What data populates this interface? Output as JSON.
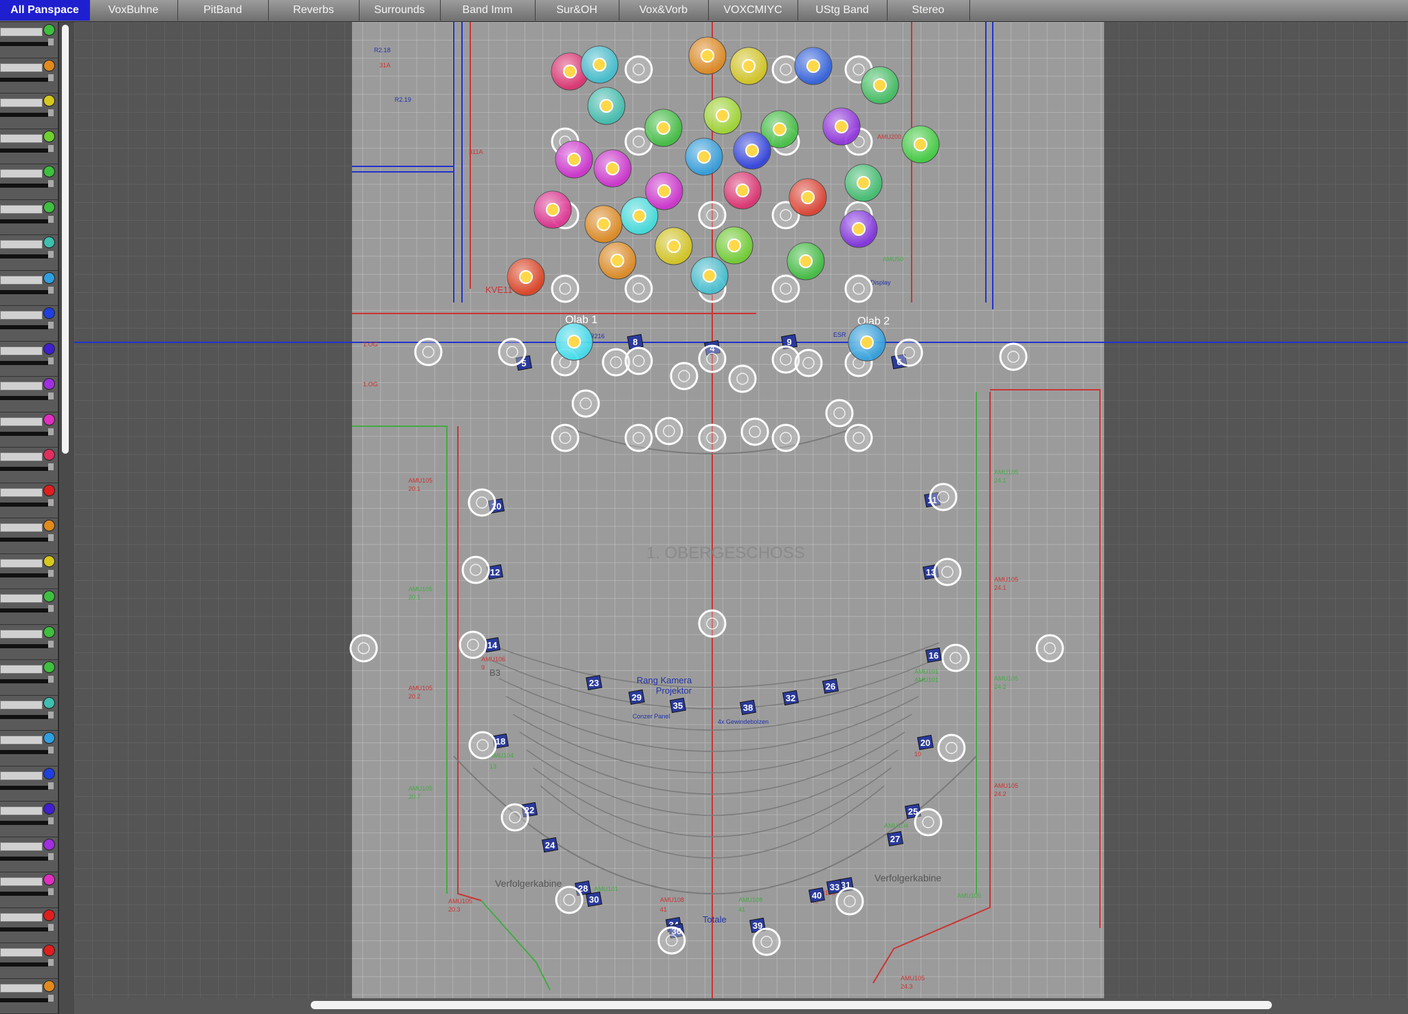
{
  "tabs": [
    {
      "label": "All Panspace",
      "active": true
    },
    {
      "label": "VoxBuhne"
    },
    {
      "label": "PitBand"
    },
    {
      "label": "Reverbs"
    },
    {
      "label": "Surrounds"
    },
    {
      "label": "Band Imm"
    },
    {
      "label": "Sur&OH"
    },
    {
      "label": "Vox&Vorb"
    },
    {
      "label": "VOXCMIYC"
    },
    {
      "label": "UStg Band"
    },
    {
      "label": "Stereo"
    }
  ],
  "channel_colors": [
    "#3fbf3f",
    "#e08a1e",
    "#d6c81e",
    "#6fcf2f",
    "#3fbf3f",
    "#3fbf3f",
    "#3fbfaf",
    "#2f9fdf",
    "#1f3fdf",
    "#3f1fcf",
    "#9f2fdf",
    "#df2fbf",
    "#df2f5f",
    "#df1f1f",
    "#e08a1e",
    "#d6c81e",
    "#3fbf3f",
    "#3fbf3f",
    "#3fbf3f",
    "#3fbfaf",
    "#2f9fdf",
    "#1f3fdf",
    "#3f1fcf",
    "#9f2fdf",
    "#df2fbf",
    "#df1f1f",
    "#df1f1f",
    "#e08a1e"
  ],
  "floorplan": {
    "title": "1. OBERGESCHOSS",
    "labels": [
      "Qlab 1",
      "Qlab 2",
      "Rang Kamera",
      "Projektor",
      "Verfolgerkabine",
      "Verfolgerkabine",
      "Totale",
      "Conzer Panel",
      "4x Gewindebolzen",
      "B3",
      "1.OG",
      "1.OG",
      "KVE11",
      "R2.18",
      "R2.19",
      "31A",
      "311A",
      "ER216",
      "ESR"
    ],
    "amu_labels": [
      "AMU105",
      "20.1",
      "AMU105",
      "20.1",
      "AMU105",
      "20.2",
      "AMU105",
      "20.7",
      "AMU105",
      "20.3",
      "AMU105",
      "24.1",
      "AMU105",
      "24.1",
      "AMU105",
      "24.2",
      "AMU105",
      "24.2",
      "AMU105",
      "24.3",
      "AMU106",
      "9",
      "AMU104",
      "13",
      "AMU108",
      "41",
      "AMU108",
      "41",
      "AMU101",
      "AMU105",
      "AMU104",
      "10",
      "AMU101",
      "AMU101",
      "AMU105",
      "40",
      "AMU200",
      "AMU50",
      "Display"
    ],
    "speaker_numbers": [
      "5",
      "6",
      "8",
      "9",
      "4",
      "10",
      "11",
      "12",
      "13",
      "14",
      "16",
      "18",
      "20",
      "22",
      "23",
      "24",
      "25",
      "26",
      "27",
      "28",
      "29",
      "30",
      "31",
      "32",
      "33",
      "34",
      "35",
      "36",
      "38",
      "39",
      "40"
    ]
  }
}
